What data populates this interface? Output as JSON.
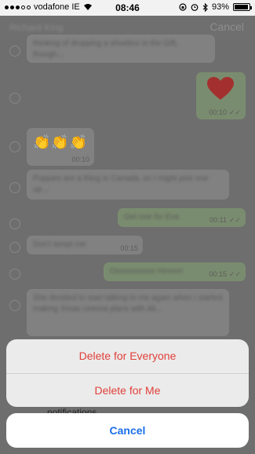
{
  "status_bar": {
    "carrier": "vodafone IE",
    "time": "08:46",
    "battery": "93%",
    "battery_level": 0.93
  },
  "header": {
    "contact_name": "Richard King",
    "cancel_label": "Cancel"
  },
  "messages": [
    {
      "direction": "in",
      "text": "thinking of dropping a shoebox in the Gift, though...",
      "time": ""
    },
    {
      "direction": "out",
      "emoji": "red-heart",
      "time": "00:10"
    },
    {
      "direction": "in",
      "emoji": "clapping-hands",
      "time": "00:10"
    },
    {
      "direction": "in",
      "text": "Puppies are a thing in Canada, so I might pick one up...",
      "time": ""
    },
    {
      "direction": "out",
      "text": "Get one for Eva",
      "time": "00:11"
    },
    {
      "direction": "in",
      "text": "Don't tempt me",
      "time": "00:15"
    },
    {
      "direction": "out",
      "text": "Oooooooooo Hmmm",
      "time": "00:15"
    },
    {
      "direction": "in",
      "text": "She decided to start talking to me again when I started making Xmas cinema plans with Ali...",
      "time": ""
    }
  ],
  "action_sheet": {
    "delete_everyone": "Delete for Everyone",
    "delete_me": "Delete for Me",
    "peek_text": "notifications",
    "cancel": "Cancel"
  }
}
